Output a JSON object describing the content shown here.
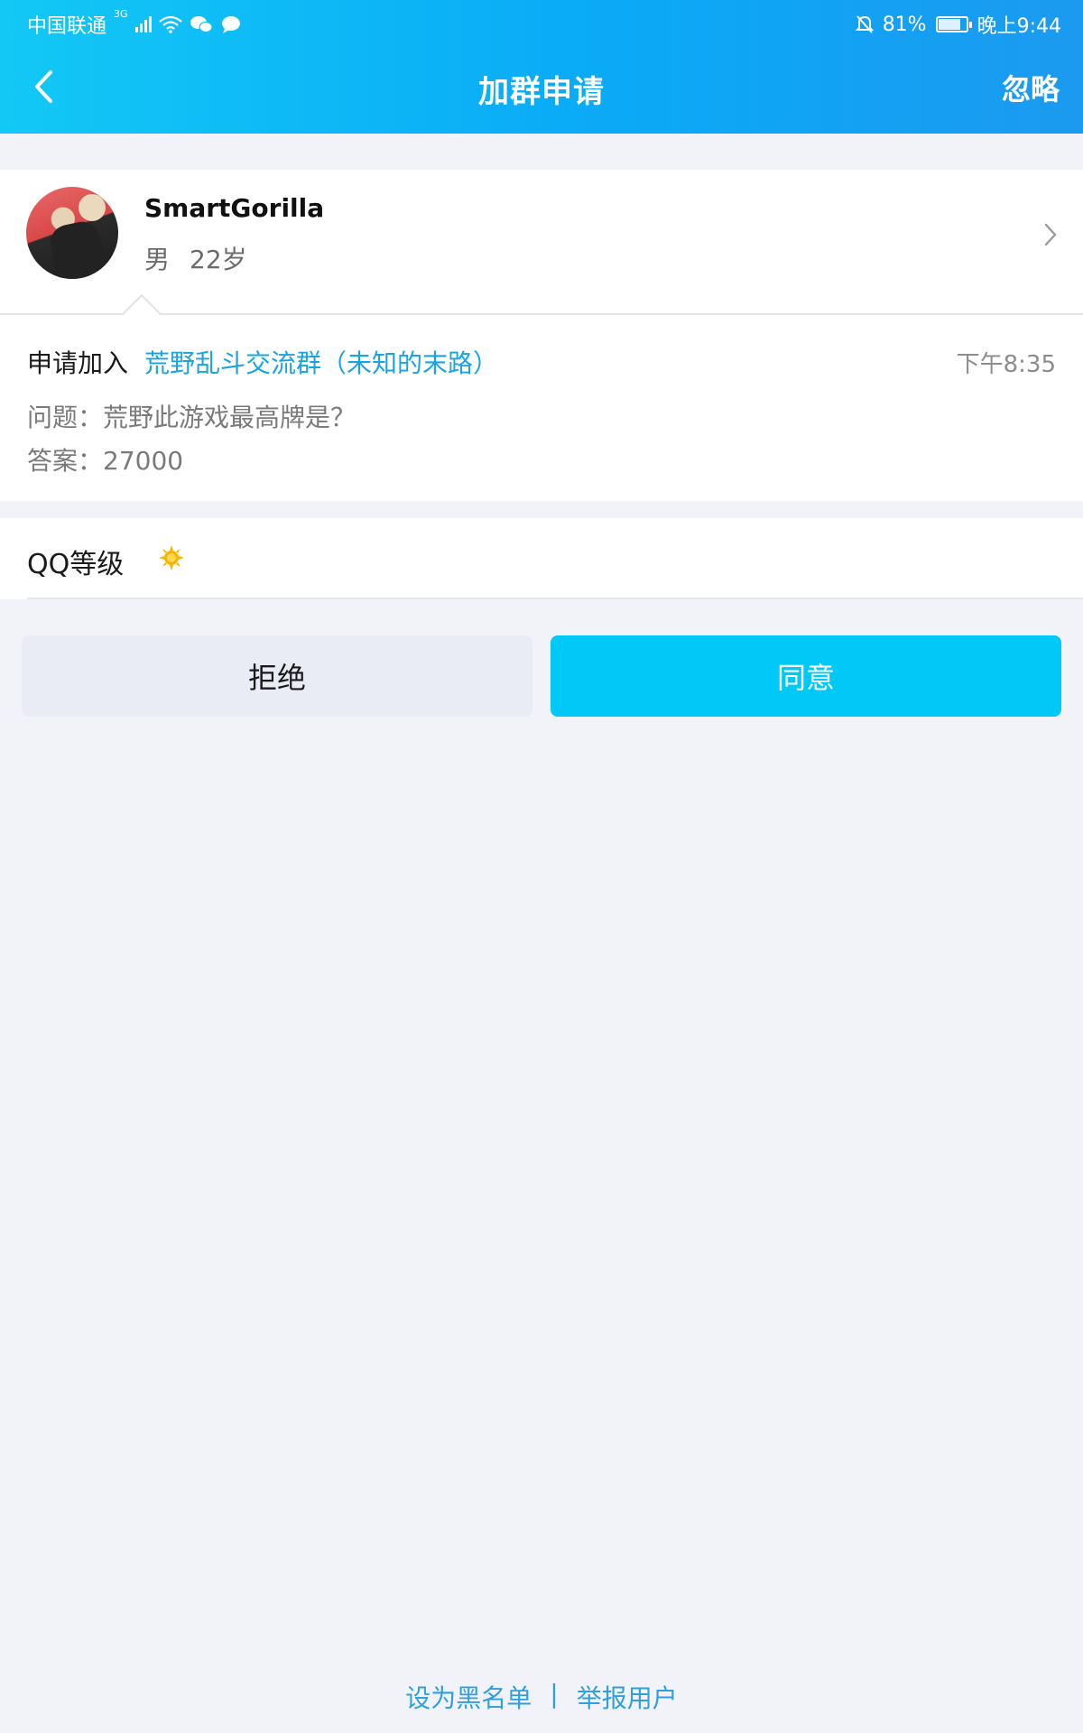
{
  "status_bar": {
    "carrier": "中国联通",
    "network": "3G",
    "battery": "81%",
    "battery_level": 0.81,
    "time": "晚上9:44"
  },
  "nav": {
    "title": "加群申请",
    "ignore": "忽略"
  },
  "profile": {
    "name": "SmartGorilla",
    "gender": "男",
    "age": "22岁"
  },
  "request": {
    "label": "申请加入",
    "group": "荒野乱斗交流群（未知的末路）",
    "time": "下午8:35",
    "question": "问题：荒野此游戏最高牌是？",
    "answer": "答案：27000"
  },
  "qq_level": {
    "label": "QQ等级",
    "icon": "sun-icon"
  },
  "actions": {
    "reject": "拒绝",
    "accept": "同意"
  },
  "footer": {
    "blacklist": "设为黑名单",
    "separator": "|",
    "report": "举报用户"
  },
  "colors": {
    "header_gradient_start": "#12c8f5",
    "header_gradient_end": "#1b9af0",
    "accent": "#00c8f7",
    "link": "#18a4e3",
    "reject_bg": "#e9ecf4",
    "page_bg": "#f2f3f8"
  }
}
